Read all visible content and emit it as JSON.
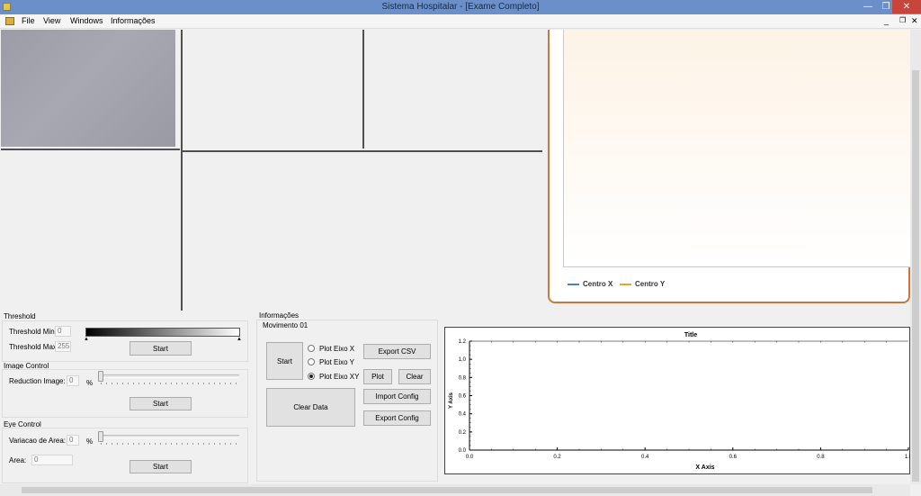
{
  "window": {
    "title": "Sistema Hospitalar - [Exame Completo]"
  },
  "menu": {
    "file": "File",
    "view": "View",
    "windows": "Windows",
    "info": "Informações"
  },
  "legend": {
    "centro_x": "Centro X",
    "centro_y": "Centro Y",
    "color_x": "#4a7fd4",
    "color_y": "#f0a22c"
  },
  "threshold": {
    "group_label": "Threshold",
    "min_label": "Threshold Min:",
    "min_value": "0",
    "max_label": "Threshold Max:",
    "max_value": "255",
    "start_label": "Start"
  },
  "image_control": {
    "group_label": "Image Control",
    "reduction_label": "Reduction Image:",
    "reduction_value": "0",
    "percent": "%",
    "start_label": "Start"
  },
  "eye_control": {
    "group_label": "Eye Control",
    "variation_label": "Variacao de Area:",
    "variation_value": "0",
    "percent": "%",
    "area_label": "Area:",
    "area_value": "0",
    "start_label": "Start"
  },
  "info": {
    "group_label": "Informações",
    "movement_label": "Movimento 01",
    "start_label": "Start",
    "clear_data_label": "Clear Data",
    "radio_x": "Plot Eixo X",
    "radio_y": "Plot Eixo Y",
    "radio_xy": "Plot Eixo XY",
    "export_csv": "Export CSV",
    "plot": "Plot",
    "clear": "Clear",
    "import_config": "Import Config",
    "export_config": "Export Config"
  },
  "chart_data": {
    "type": "line",
    "title": "Title",
    "xlabel": "X Axis",
    "ylabel": "Y Axis",
    "xlim": [
      0,
      1.0
    ],
    "ylim": [
      0,
      1.2
    ],
    "x_ticks": [
      "0.0",
      "0.2",
      "0.4",
      "0.6",
      "0.8",
      "1.0"
    ],
    "y_ticks": [
      "0.0",
      "0.2",
      "0.4",
      "0.6",
      "0.8",
      "1.0",
      "1.2"
    ],
    "series": []
  }
}
